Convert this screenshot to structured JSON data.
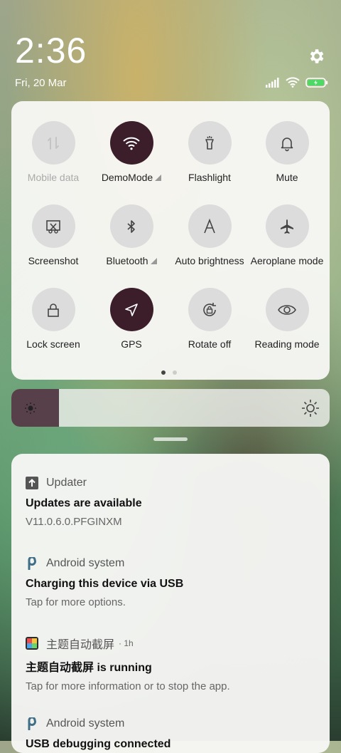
{
  "status": {
    "time": "2:36",
    "date": "Fri, 20 Mar"
  },
  "tiles": [
    {
      "label": "Mobile data",
      "icon": "mobile-data-icon",
      "active": false,
      "disabled": true
    },
    {
      "label": "DemoMode",
      "icon": "wifi-icon",
      "active": true,
      "has_more": true
    },
    {
      "label": "Flashlight",
      "icon": "flashlight-icon",
      "active": false
    },
    {
      "label": "Mute",
      "icon": "bell-icon",
      "active": false
    },
    {
      "label": "Screenshot",
      "icon": "screenshot-icon",
      "active": false
    },
    {
      "label": "Bluetooth",
      "icon": "bluetooth-icon",
      "active": false,
      "has_more": true
    },
    {
      "label": "Auto brightness",
      "icon": "auto-brightness-icon",
      "active": false
    },
    {
      "label": "Aeroplane mode",
      "icon": "airplane-icon",
      "active": false
    },
    {
      "label": "Lock screen",
      "icon": "lock-icon",
      "active": false
    },
    {
      "label": "GPS",
      "icon": "location-icon",
      "active": true
    },
    {
      "label": "Rotate off",
      "icon": "rotate-lock-icon",
      "active": false
    },
    {
      "label": "Reading mode",
      "icon": "eye-icon",
      "active": false
    }
  ],
  "brightness": {
    "level": 0.15
  },
  "colors": {
    "active_tile": "#3b1e2a",
    "inactive_tile": "#dcdcdc",
    "brightness_fill": "#57404a",
    "battery": "#4cd964"
  },
  "notifications": [
    {
      "app": "Updater",
      "title": "Updates are available",
      "text": "V11.0.6.0.PFGINXM",
      "icon": "updater-icon"
    },
    {
      "app": "Android system",
      "title": "Charging this device via USB",
      "text": "Tap for more options.",
      "icon": "android-system-icon"
    },
    {
      "app": "主题自动截屏",
      "time": "· 1h",
      "title": "主题自动截屏 is running",
      "text": "Tap for more information or to stop the app.",
      "icon": "theme-app-icon"
    },
    {
      "app": "Android system",
      "title": "USB debugging connected",
      "icon": "android-system-icon"
    }
  ]
}
